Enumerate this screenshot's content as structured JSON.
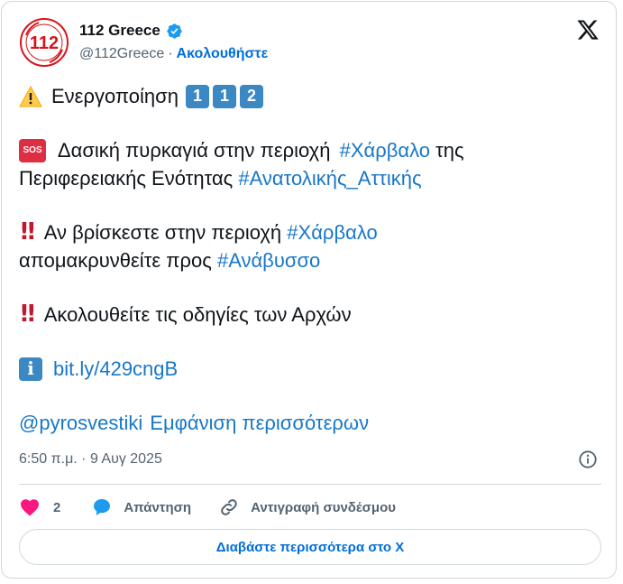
{
  "author": {
    "display_name": "112 Greece",
    "handle": "@112Greece",
    "separator": "·",
    "follow_label": "Ακολουθήστε",
    "avatar_text": "112",
    "avatar_ring_text": "ΕΥΡΩΠΑΪΚΟΣ ΑΡΙΘΜΟΣ ΕΚΤΑΚΤΗΣ ΑΝΑΓΚΗΣ"
  },
  "tweet": {
    "line1_text": "Ενεργοποίηση",
    "line1_keys": [
      "1",
      "1",
      "2"
    ],
    "line2_sos": "SOS",
    "line2_text": " Δασική πυρκαγιά στην περιοχή ",
    "line2_hashtag": "#Χάρβαλο",
    "line2_tail": " της",
    "line3_text": "Περιφερειακής Ενότητας ",
    "line3_hashtag": "#Ανατολικής_Αττικής",
    "line4_bang": "!!",
    "line4_text": "Αν βρίσκεστε στην περιοχή ",
    "line4_hashtag": "#Χάρβαλο",
    "line5_text": "απομακρυνθείτε προς ",
    "line5_hashtag": "#Ανάβυσσο",
    "line6_bang": "!!",
    "line6_text": "Ακολουθείτε τις οδηγίες των Αρχών",
    "line7_info": "i",
    "line7_link": "bit.ly/429cngB",
    "line8_mention": "@pyrosvestiki",
    "line8_more": "Εμφάνιση περισσότερων"
  },
  "meta": {
    "timestamp": "6:50 π.μ. · 9 Αυγ 2025"
  },
  "actions": {
    "like_count": "2",
    "reply_label": "Απάντηση",
    "copy_label": "Αντιγραφή συνδέσμου"
  },
  "read_more_label": "Διαβάστε περισσότερα στο X",
  "colors": {
    "link": "#1877c8",
    "accent": "#006fd6",
    "heart": "#f91880",
    "muted": "#536471",
    "border": "#cfd9de"
  }
}
